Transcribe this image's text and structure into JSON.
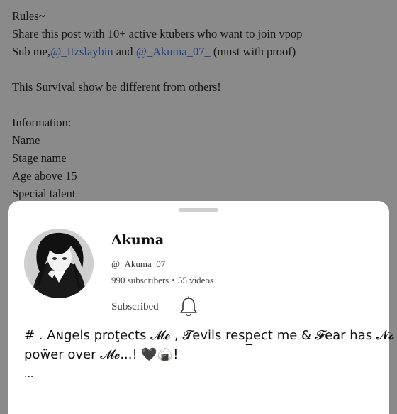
{
  "post": {
    "title": "Rules~",
    "line1": "Share this post with 10+ active ktubers who want to join vpop",
    "sub_prefix": "Sub me,",
    "mention1": "@_Itzslaybin",
    "and_word": " and ",
    "mention2": "@_Akuma_07_",
    "sub_suffix": " (must with proof)",
    "survival": "This Survival show be different from others!",
    "info_heading": "Information:",
    "field_name": "Name",
    "field_stage": "Stage name",
    "field_age": "Age above 15",
    "field_talent": "Special talent"
  },
  "channel": {
    "name": "Akuma",
    "handle": "@_Akuma_07_",
    "subscribers": "990 subscribers",
    "separator": "•",
    "videos": "55 videos",
    "subscribe_state": "Subscribed",
    "description_line1": "# . Aɴgels proţects 𝓜𝓮 , 𝓣evils resp̲ect me & 𝓕ear has 𝓝𝓸",
    "description_line2": "poẅer over 𝓜𝓮...! 🖤🍙!",
    "more": "..."
  },
  "icons": {
    "bell": "bell-icon",
    "avatar": "avatar-image"
  },
  "colors": {
    "overlay": "#8a8a8a",
    "mention": "#1f3e82",
    "sheet": "#ffffff"
  }
}
